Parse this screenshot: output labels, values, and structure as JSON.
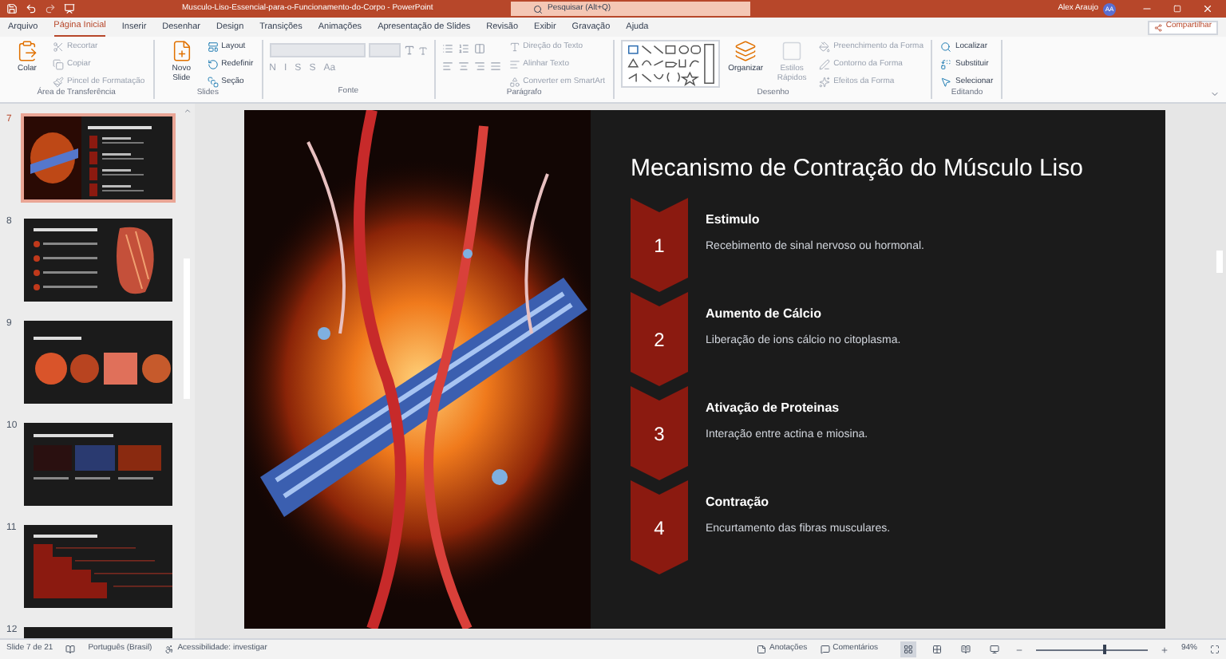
{
  "title_bar": {
    "document_title": "Musculo-Liso-Essencial-para-o-Funcionamento-do-Corpo  -  PowerPoint",
    "search_placeholder": "Pesquisar (Alt+Q)",
    "user_name": "Alex Araujo",
    "user_initials": "AA"
  },
  "tabs": [
    {
      "label": "Arquivo",
      "selected": false
    },
    {
      "label": "Página Inicial",
      "selected": true
    },
    {
      "label": "Inserir",
      "selected": false
    },
    {
      "label": "Desenhar",
      "selected": false
    },
    {
      "label": "Design",
      "selected": false
    },
    {
      "label": "Transições",
      "selected": false
    },
    {
      "label": "Animações",
      "selected": false
    },
    {
      "label": "Apresentação de Slides",
      "selected": false
    },
    {
      "label": "Revisão",
      "selected": false
    },
    {
      "label": "Exibir",
      "selected": false
    },
    {
      "label": "Gravação",
      "selected": false
    },
    {
      "label": "Ajuda",
      "selected": false
    }
  ],
  "share_button": "Compartilhar",
  "ribbon_groups": [
    {
      "label": "Área de Transferência",
      "kind": "standard",
      "large": [
        {
          "label": "Colar",
          "disabled": false
        }
      ],
      "small": [
        {
          "label": "Recortar",
          "disabled": true
        },
        {
          "label": "Copiar",
          "disabled": true
        },
        {
          "label": "Pincel de Formatação",
          "disabled": true
        }
      ]
    },
    {
      "label": "Slides",
      "kind": "standard",
      "large": [
        {
          "label": "Novo Slide",
          "disabled": false
        }
      ],
      "small": [
        {
          "label": "Layout",
          "disabled": false
        },
        {
          "label": "Redefinir",
          "disabled": false
        },
        {
          "label": "Seção",
          "disabled": false
        }
      ]
    },
    {
      "label": "Fonte",
      "kind": "font",
      "format_buttons": [
        "N",
        "I",
        "S",
        "S",
        "Aa"
      ]
    },
    {
      "label": "Parágrafo",
      "kind": "paragraph",
      "small": [
        {
          "label": "Direção do Texto",
          "disabled": true
        },
        {
          "label": "Alinhar Texto",
          "disabled": true
        },
        {
          "label": "Converter em SmartArt",
          "disabled": true
        }
      ]
    },
    {
      "label": "Desenho",
      "kind": "drawing",
      "large": [
        {
          "label": "Organizar",
          "disabled": false
        },
        {
          "label": "Estilos Rápidos",
          "disabled": true
        }
      ],
      "small": [
        {
          "label": "Preenchimento da Forma",
          "disabled": true
        },
        {
          "label": "Contorno da Forma",
          "disabled": true
        },
        {
          "label": "Efeitos da Forma",
          "disabled": true
        }
      ]
    },
    {
      "label": "Editando",
      "kind": "standard",
      "small": [
        {
          "label": "Localizar",
          "disabled": false
        },
        {
          "label": "Substituir",
          "disabled": false
        },
        {
          "label": "Selecionar",
          "disabled": false
        }
      ]
    }
  ],
  "thumbnails": [
    {
      "number": "7",
      "selected": true,
      "kind": "steps"
    },
    {
      "number": "8",
      "selected": false,
      "kind": "regulation"
    },
    {
      "number": "9",
      "selected": false,
      "kind": "types"
    },
    {
      "number": "10",
      "selected": false,
      "kind": "location"
    },
    {
      "number": "11",
      "selected": false,
      "kind": "chart"
    },
    {
      "number": "12",
      "selected": false,
      "kind": "respiratory"
    }
  ],
  "slide": {
    "title": "Mecanismo de Contração do Músculo Liso",
    "steps": [
      {
        "number": "1",
        "heading": "Estimulo",
        "text": "Recebimento de sinal nervoso ou hormonal."
      },
      {
        "number": "2",
        "heading": "Aumento de Cálcio",
        "text": "Liberação de ions cálcio no citoplasma."
      },
      {
        "number": "3",
        "heading": "Ativação de Proteinas",
        "text": "Interação entre actina e miosina."
      },
      {
        "number": "4",
        "heading": "Contração",
        "text": "Encurtamento das fibras musculares."
      }
    ]
  },
  "status_bar": {
    "slide_info": "Slide 7 de 21",
    "language": "Português (Brasil)",
    "accessibility": "Acessibilidade: investigar",
    "notes_button": "Anotações",
    "comments_button": "Comentários",
    "view_buttons": [
      {
        "kind": "normal",
        "selected": true
      },
      {
        "kind": "sorter",
        "selected": false
      },
      {
        "kind": "reading",
        "selected": false
      },
      {
        "kind": "slideshow",
        "selected": false
      }
    ],
    "zoom_slider": {
      "level": 0.6
    },
    "zoom": "94%"
  }
}
